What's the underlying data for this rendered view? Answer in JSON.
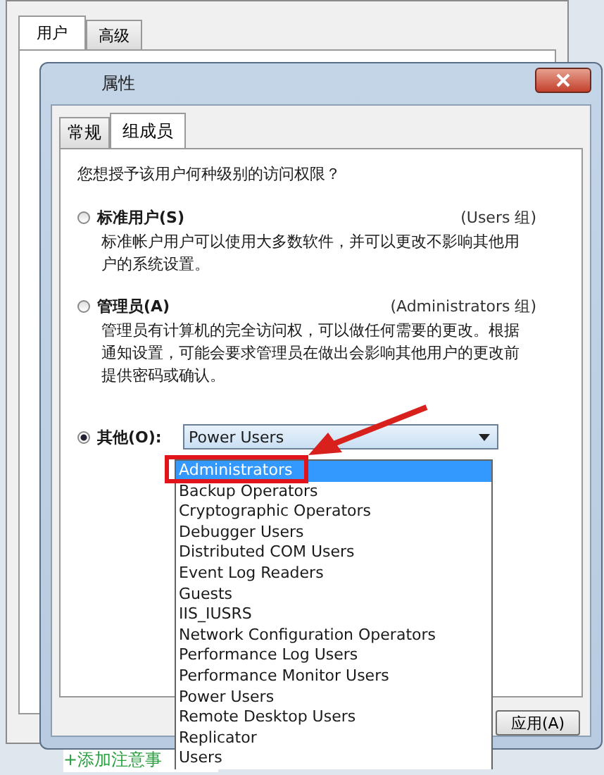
{
  "background_window": {
    "tabs": [
      {
        "label": "用户",
        "selected": true
      },
      {
        "label": "高级",
        "selected": false
      }
    ]
  },
  "dialog": {
    "title": "属性",
    "tabs": [
      {
        "label": "常规",
        "selected": false
      },
      {
        "label": "组成员",
        "selected": true
      }
    ],
    "prompt": "您想授予该用户何种级别的访问权限？",
    "options": [
      {
        "kind": "described",
        "label": "标准用户(S)",
        "group": "(Users 组)",
        "description": "标准帐户用户可以使用大多数软件，并可以更改不影响其他用户的系统设置。",
        "selected": false
      },
      {
        "kind": "described",
        "label": "管理员(A)",
        "group": "(Administrators 组)",
        "description": "管理员有计算机的完全访问权，可以做任何需要的更改。根据通知设置，可能会要求管理员在做出会影响其他用户的更改前提供密码或确认。",
        "selected": false
      },
      {
        "kind": "combo",
        "label": "其他(O):",
        "value": "Power Users",
        "selected": true,
        "items": [
          {
            "label": "Administrators",
            "highlighted": true
          },
          {
            "label": "Backup Operators",
            "highlighted": false
          },
          {
            "label": "Cryptographic Operators",
            "highlighted": false
          },
          {
            "label": "Debugger Users",
            "highlighted": false
          },
          {
            "label": "Distributed COM Users",
            "highlighted": false
          },
          {
            "label": "Event Log Readers",
            "highlighted": false
          },
          {
            "label": "Guests",
            "highlighted": false
          },
          {
            "label": "IIS_IUSRS",
            "highlighted": false
          },
          {
            "label": "Network Configuration Operators",
            "highlighted": false
          },
          {
            "label": "Performance Log Users",
            "highlighted": false
          },
          {
            "label": "Performance Monitor Users",
            "highlighted": false
          },
          {
            "label": "Power Users",
            "highlighted": false
          },
          {
            "label": "Remote Desktop Users",
            "highlighted": false
          },
          {
            "label": "Replicator",
            "highlighted": false
          },
          {
            "label": "Users",
            "highlighted": false
          }
        ]
      }
    ],
    "apply_button": "应用(A)"
  },
  "footer_link": "+添加注意事"
}
